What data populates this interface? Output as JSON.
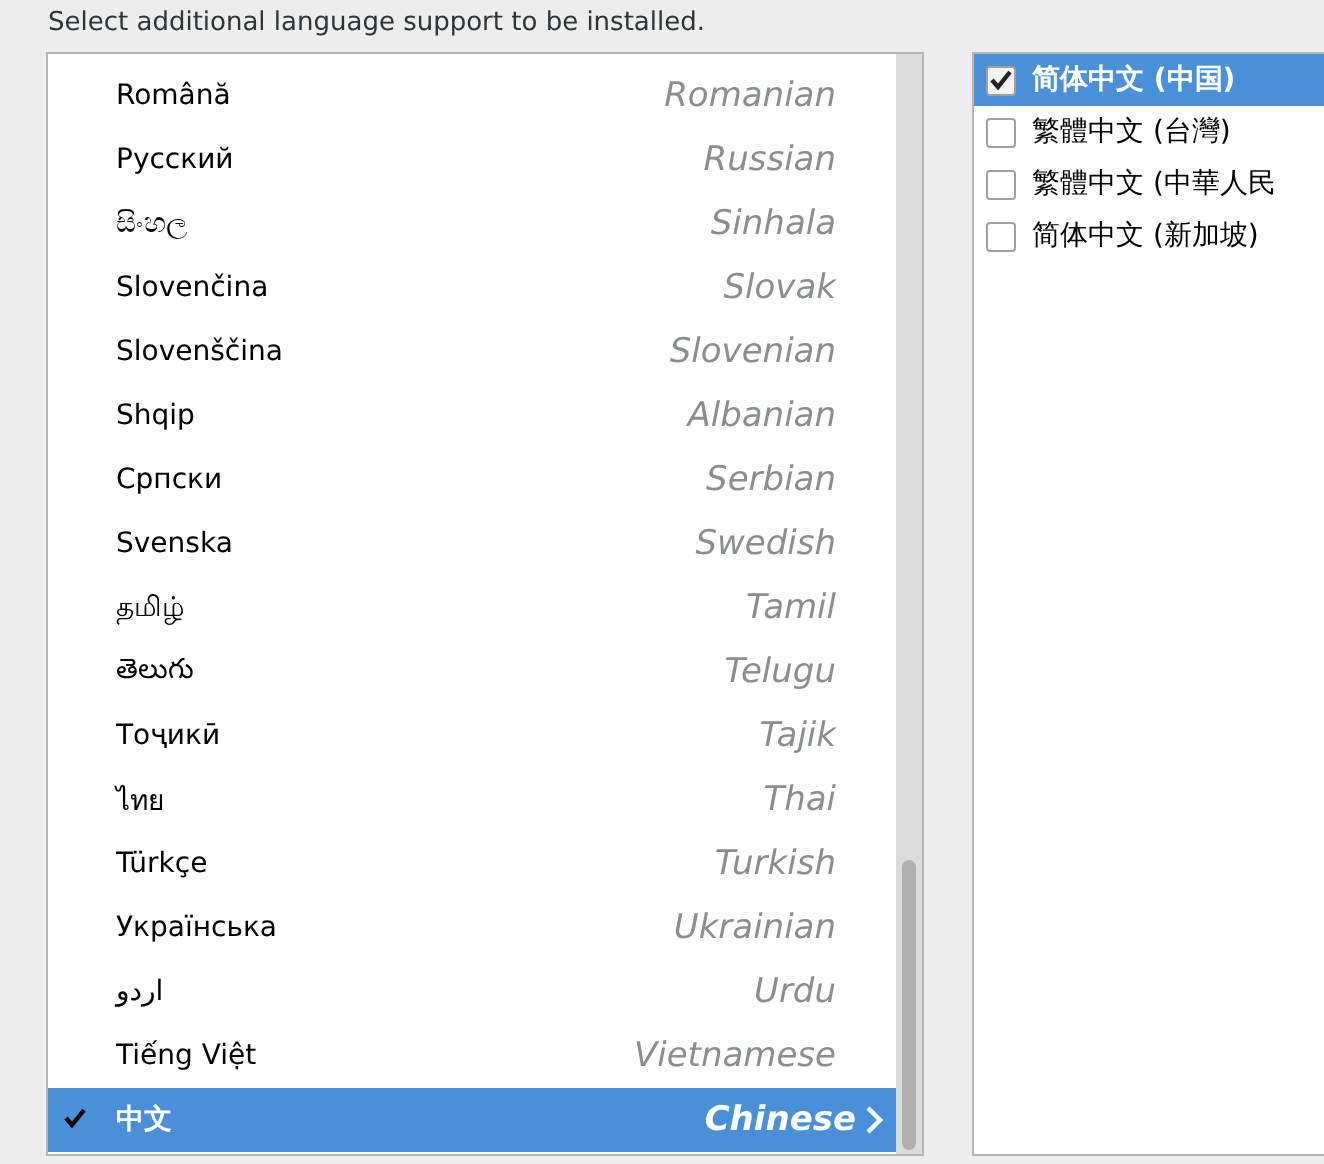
{
  "instruction": "Select additional language support to be installed.",
  "languages": [
    {
      "native": "Română",
      "english": "Romanian",
      "selected": false
    },
    {
      "native": "Русский",
      "english": "Russian",
      "selected": false
    },
    {
      "native": "සිංහල",
      "english": "Sinhala",
      "selected": false
    },
    {
      "native": "Slovenčina",
      "english": "Slovak",
      "selected": false
    },
    {
      "native": "Slovenščina",
      "english": "Slovenian",
      "selected": false
    },
    {
      "native": "Shqip",
      "english": "Albanian",
      "selected": false
    },
    {
      "native": "Српски",
      "english": "Serbian",
      "selected": false
    },
    {
      "native": "Svenska",
      "english": "Swedish",
      "selected": false
    },
    {
      "native": "தமிழ்",
      "english": "Tamil",
      "selected": false
    },
    {
      "native": "తెలుగు",
      "english": "Telugu",
      "selected": false
    },
    {
      "native": "Тоҷикӣ",
      "english": "Tajik",
      "selected": false
    },
    {
      "native": "ไทย",
      "english": "Thai",
      "selected": false
    },
    {
      "native": "Türkçe",
      "english": "Turkish",
      "selected": false
    },
    {
      "native": "Українська",
      "english": "Ukrainian",
      "selected": false
    },
    {
      "native": "اردو",
      "english": "Urdu",
      "selected": false
    },
    {
      "native": "Tiếng Việt",
      "english": "Vietnamese",
      "selected": false
    },
    {
      "native": "中文",
      "english": "Chinese",
      "selected": true
    }
  ],
  "locales": [
    {
      "label": "简体中文 (中国)",
      "checked": true,
      "selected": true
    },
    {
      "label": "繁體中文 (台灣)",
      "checked": false,
      "selected": false
    },
    {
      "label": "繁體中文 (中華人民",
      "checked": false,
      "selected": false
    },
    {
      "label": "简体中文 (新加坡)",
      "checked": false,
      "selected": false
    }
  ]
}
